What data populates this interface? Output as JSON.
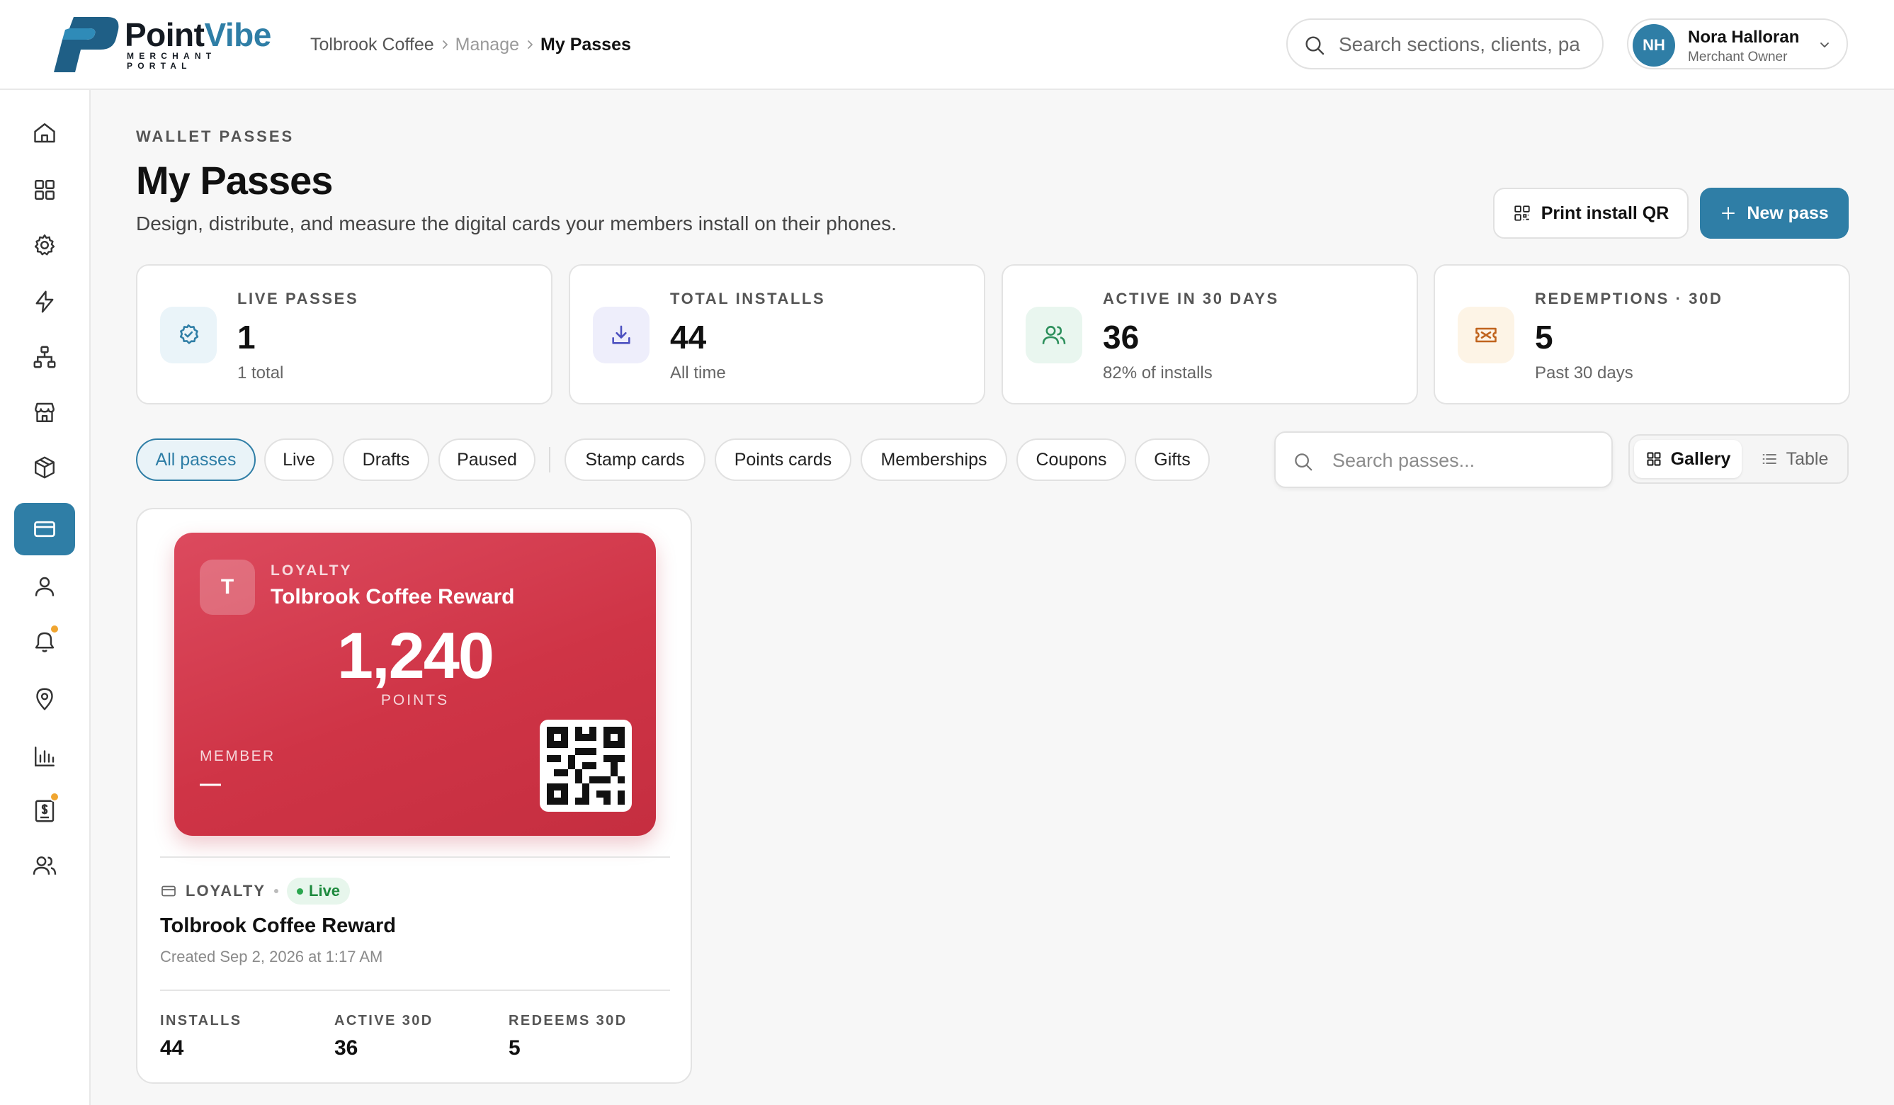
{
  "brand": {
    "name_main": "Point",
    "name_accent": "Vibe",
    "tagline": "MERCHANT PORTAL",
    "logo_icon": "pointvibe-logo-icon"
  },
  "breadcrumb": {
    "items": [
      "Tolbrook Coffee",
      "Manage",
      "My Passes"
    ]
  },
  "global_search": {
    "placeholder": "Search sections, clients, pa"
  },
  "user": {
    "initials": "NH",
    "name": "Nora Halloran",
    "role": "Merchant Owner"
  },
  "sidebar": {
    "items": [
      {
        "icon": "home-icon"
      },
      {
        "icon": "dashboard-icon"
      },
      {
        "icon": "settings-icon"
      },
      {
        "icon": "bolt-icon"
      },
      {
        "icon": "network-icon"
      },
      {
        "icon": "store-icon"
      },
      {
        "icon": "box-icon"
      },
      {
        "icon": "wallet-card-icon",
        "active": true
      },
      {
        "icon": "user-icon"
      },
      {
        "icon": "bell-icon",
        "badge": true
      },
      {
        "icon": "map-pin-icon"
      },
      {
        "icon": "bar-chart-icon"
      },
      {
        "icon": "invoice-icon",
        "badge": true
      },
      {
        "icon": "team-icon"
      }
    ]
  },
  "header": {
    "eyebrow": "WALLET PASSES",
    "title": "My Passes",
    "subtitle": "Design, distribute, and measure the digital cards your members install on their phones."
  },
  "actions": {
    "print_qr": "Print install QR",
    "new_pass": "New pass"
  },
  "stats": [
    {
      "label": "LIVE PASSES",
      "value": "1",
      "sub": "1 total",
      "icon": "badge-check-icon",
      "color": "#2f7ea6"
    },
    {
      "label": "TOTAL INSTALLS",
      "value": "44",
      "sub": "All time",
      "icon": "download-icon",
      "color": "#4c50c0"
    },
    {
      "label": "ACTIVE IN 30 DAYS",
      "value": "36",
      "sub": "82% of installs",
      "icon": "users-icon",
      "color": "#2c8f5b"
    },
    {
      "label": "REDEMPTIONS · 30D",
      "value": "5",
      "sub": "Past 30 days",
      "icon": "ticket-icon",
      "color": "#c0641e"
    }
  ],
  "filters": {
    "status": [
      "All passes",
      "Live",
      "Drafts",
      "Paused"
    ],
    "types": [
      "Stamp cards",
      "Points cards",
      "Memberships",
      "Coupons",
      "Gifts"
    ],
    "active": "All passes"
  },
  "pass_search": {
    "placeholder": "Search passes..."
  },
  "view": {
    "gallery": "Gallery",
    "table": "Table",
    "active": "Gallery"
  },
  "passes": [
    {
      "preview": {
        "initial": "T",
        "type": "LOYALTY",
        "name": "Tolbrook Coffee Reward",
        "points": "1,240",
        "unit": "POINTS",
        "member_label": "MEMBER",
        "member_value": "—",
        "color": "#d13a4d"
      },
      "type": "LOYALTY",
      "status": "Live",
      "name": "Tolbrook Coffee Reward",
      "created": "Created Sep 2, 2026 at 1:17 AM",
      "metrics": [
        {
          "label": "INSTALLS",
          "value": "44"
        },
        {
          "label": "ACTIVE 30D",
          "value": "36"
        },
        {
          "label": "REDEEMS 30D",
          "value": "5"
        }
      ]
    }
  ]
}
